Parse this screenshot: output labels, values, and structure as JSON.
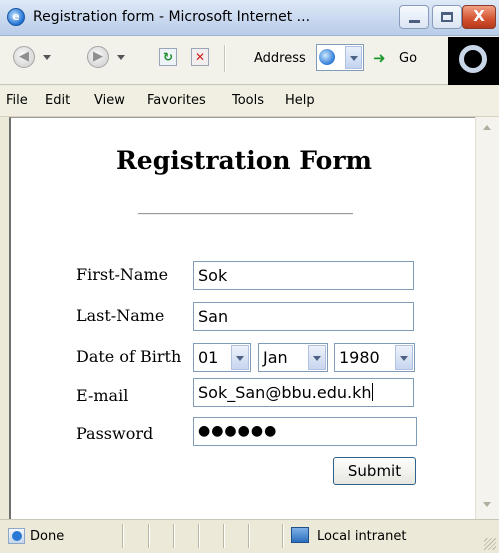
{
  "window": {
    "title": "Registration form - Microsoft Internet ...",
    "close_symbol": "X"
  },
  "toolbar": {
    "address_label": "Address",
    "go_label": "Go"
  },
  "menu": [
    "File",
    "Edit",
    "View",
    "Favorites",
    "Tools",
    "Help"
  ],
  "form": {
    "heading": "Registration Form",
    "first_name_label": "First-Name",
    "first_name_value": "Sok",
    "last_name_label": "Last-Name",
    "last_name_value": "San",
    "dob_label": "Date of Birth",
    "dob_day": "01",
    "dob_month": "Jan",
    "dob_year": "1980",
    "email_label": "E-mail",
    "email_value": "Sok_San@bbu.edu.kh",
    "password_label": "Password",
    "password_value": "●●●●●●",
    "submit_label": "Submit"
  },
  "status": {
    "text": "Done",
    "zone": "Local intranet"
  },
  "icons": {
    "browser": "ie-logo-icon",
    "back": "back-arrow-icon",
    "forward": "forward-arrow-icon",
    "refresh": "refresh-icon",
    "stop": "stop-icon",
    "go": "go-arrow-icon",
    "status": "page-done-icon",
    "zone": "local-intranet-icon"
  },
  "colors": {
    "title_bar": "#c7d7ee",
    "close_button": "#d2522f",
    "chrome": "#ece9d8",
    "field_border": "#7f9db9",
    "submit_border": "#2c628b"
  }
}
